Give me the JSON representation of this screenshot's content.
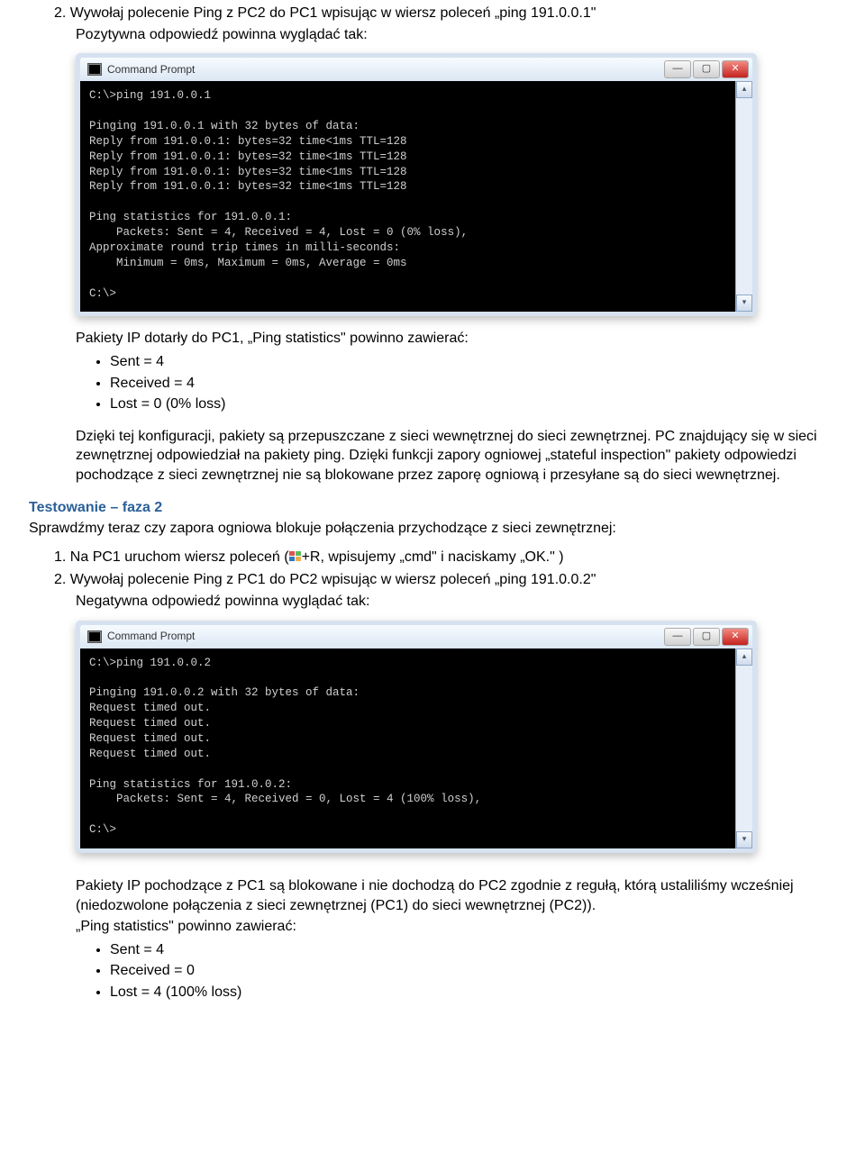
{
  "intro": {
    "numItem": "2.  Wywołaj polecenie Ping z PC2 do PC1 wpisując w wiersz poleceń „ping 191.0.0.1\"",
    "sub": "Pozytywna odpowiedź powinna wyglądać tak:"
  },
  "cmd1": {
    "title": "Command Prompt",
    "minLabel": "—",
    "maxLabel": "▢",
    "closeLabel": "✕",
    "upArrow": "▴",
    "downArrow": "▾",
    "text": "C:\\>ping 191.0.0.1\n\nPinging 191.0.0.1 with 32 bytes of data:\nReply from 191.0.0.1: bytes=32 time<1ms TTL=128\nReply from 191.0.0.1: bytes=32 time<1ms TTL=128\nReply from 191.0.0.1: bytes=32 time<1ms TTL=128\nReply from 191.0.0.1: bytes=32 time<1ms TTL=128\n\nPing statistics for 191.0.0.1:\n    Packets: Sent = 4, Received = 4, Lost = 0 (0% loss),\nApproximate round trip times in milli-seconds:\n    Minimum = 0ms, Maximum = 0ms, Average = 0ms\n\nC:\\>"
  },
  "after1": {
    "line1": "Pakiety IP dotarły do PC1, „Ping statistics\" powinno zawierać:",
    "b1": "Sent = 4",
    "b2": "Received = 4",
    "b3": "Lost = 0 (0% loss)",
    "block": "Dzięki tej konfiguracji, pakiety są przepuszczane z sieci wewnętrznej do sieci zewnętrznej. PC znajdujący się w sieci zewnętrznej odpowiedział na pakiety ping. Dzięki funkcji zapory ogniowej „stateful inspection\" pakiety odpowiedzi pochodzące z sieci zewnętrznej nie są blokowane przez zaporę ogniową i przesyłane są do sieci wewnętrznej."
  },
  "faza2": {
    "heading": "Testowanie – faza 2",
    "intro": "Sprawdźmy teraz  czy zapora ogniowa blokuje połączenia przychodzące z sieci zewnętrznej:",
    "n1a": "1.  Na PC1 uruchom wiersz poleceń (",
    "n1b": "+R, wpisujemy „cmd\" i naciskamy „OK.\" )",
    "n2": "2.  Wywołaj polecenie Ping z PC1 do PC2 wpisując w wiersz poleceń „ping 191.0.0.2\"",
    "n2sub": "Negatywna odpowiedź powinna wyglądać tak:"
  },
  "cmd2": {
    "title": "Command Prompt",
    "minLabel": "—",
    "maxLabel": "▢",
    "closeLabel": "✕",
    "upArrow": "▴",
    "downArrow": "▾",
    "text": "C:\\>ping 191.0.0.2\n\nPinging 191.0.0.2 with 32 bytes of data:\nRequest timed out.\nRequest timed out.\nRequest timed out.\nRequest timed out.\n\nPing statistics for 191.0.0.2:\n    Packets: Sent = 4, Received = 0, Lost = 4 (100% loss),\n\nC:\\>"
  },
  "after2": {
    "block": "Pakiety IP pochodzące z PC1 są blokowane i nie dochodzą do PC2 zgodnie z regułą, którą ustaliliśmy wcześniej (niedozwolone połączenia z sieci zewnętrznej (PC1) do sieci wewnętrznej (PC2)).",
    "line2": "„Ping statistics\" powinno zawierać:",
    "b1": "Sent = 4",
    "b2": "Received = 0",
    "b3": "Lost = 4 (100% loss)"
  }
}
